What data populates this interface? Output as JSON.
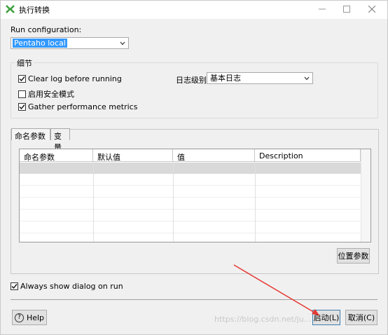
{
  "window": {
    "title": "执行转换"
  },
  "run_configuration": {
    "label": "Run configuration:",
    "value": "Pentaho local"
  },
  "details": {
    "legend": "细节",
    "clear_log": {
      "label": "Clear log before running",
      "checked": true
    },
    "safe_mode": {
      "label": "启用安全模式",
      "checked": false
    },
    "gather_metrics": {
      "label": "Gather performance metrics",
      "checked": true
    },
    "log_level": {
      "label": "日志级别",
      "value": "基本日志"
    }
  },
  "tabs": [
    {
      "label": "命名参数",
      "selected": true
    },
    {
      "label": "变量",
      "selected": false
    }
  ],
  "table": {
    "columns": [
      "命名参数",
      "默认值",
      "值",
      "Description"
    ],
    "rows": []
  },
  "position_params_button": "位置参数",
  "always_show": {
    "label": "Always show dialog on run",
    "checked": true
  },
  "footer": {
    "help": "Help",
    "start": "启动(L)",
    "cancel": "取消(C)"
  },
  "watermark": "https://blog.csdn.net/ju...",
  "colors": {
    "selection": "#3399ff",
    "annotation_arrow": "#e53935"
  },
  "icons": [
    "app-logo-icon",
    "minimize-icon",
    "maximize-icon",
    "close-icon",
    "chevron-down-icon",
    "checkmark-icon",
    "help-icon",
    "annotation-arrow"
  ]
}
